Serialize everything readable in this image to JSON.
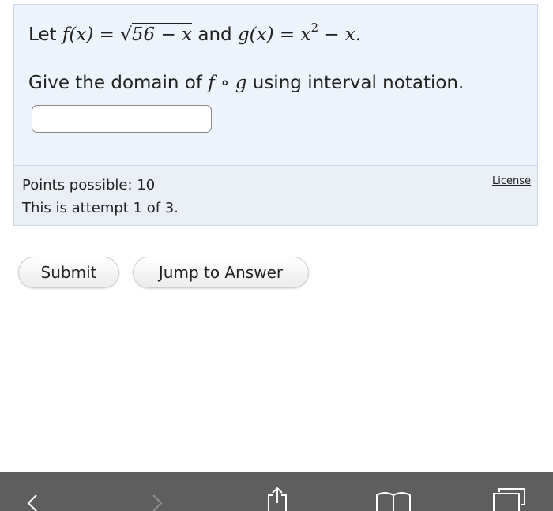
{
  "question": {
    "line1": {
      "let": "Let",
      "f_lhs": "f(x)",
      "eq1": "=",
      "sqrt_sign": "√",
      "radicand": "56 − x",
      "and": "and",
      "g_lhs": "g(x)",
      "eq2": "=",
      "g_base": "x",
      "g_exp": "2",
      "g_rest": " − x."
    },
    "line2": {
      "prefix": "Give the domain of",
      "f": "f",
      "compose": "∘",
      "g": "g",
      "suffix": "using interval notation."
    },
    "answer_value": ""
  },
  "info": {
    "points": "Points possible: 10",
    "attempt": "This is attempt 1 of 3.",
    "license": "License"
  },
  "buttons": {
    "submit": "Submit",
    "jump": "Jump to Answer"
  },
  "browser_bar": {
    "icons": [
      "back-icon",
      "forward-icon",
      "share-icon",
      "bookmarks-icon",
      "tabs-icon"
    ],
    "background": "#5e5e5e"
  }
}
